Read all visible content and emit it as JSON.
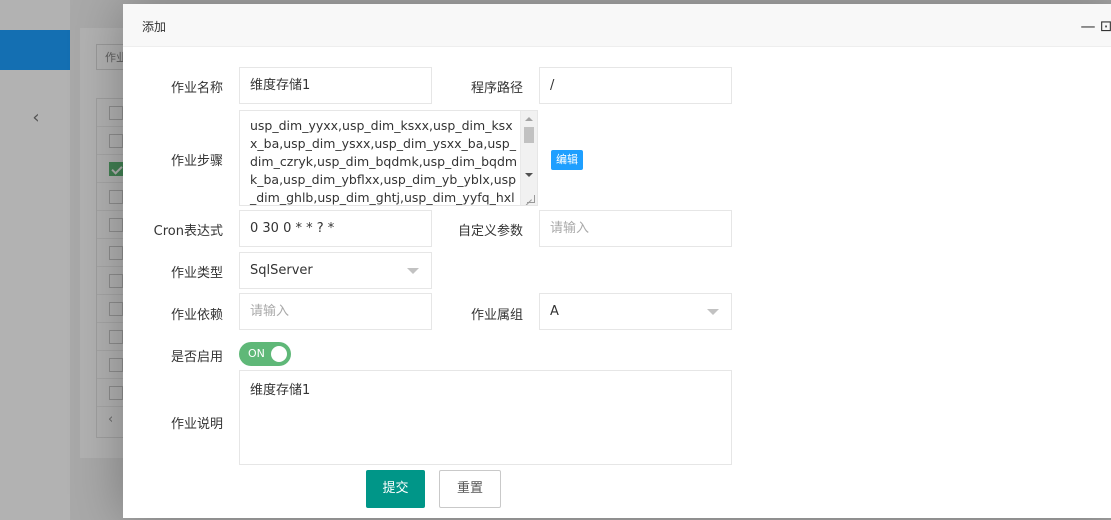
{
  "background": {
    "search_label": "作业",
    "checkbox_rows": 11,
    "checked_row_index": 2
  },
  "dialog": {
    "title": "添加",
    "window_buttons": {
      "minimize": "—",
      "maximize": "⊡",
      "close": "×"
    }
  },
  "form": {
    "job_name": {
      "label": "作业名称",
      "value": "维度存储1"
    },
    "program_path": {
      "label": "程序路径",
      "value": "/"
    },
    "job_steps": {
      "label": "作业步骤",
      "value": "usp_dim_yyxx,usp_dim_ksxx,usp_dim_ksxx_ba,usp_dim_ysxx,usp_dim_ysxx_ba,usp_dim_czryk,usp_dim_bqdmk,usp_dim_bqdmk_ba,usp_dim_ybflxx,usp_dim_yb_yblx,usp_dim_ghlb,usp_dim_ghtj,usp_dim_yyfq_hxlx,us",
      "edit_button": "编辑"
    },
    "cron": {
      "label": "Cron表达式",
      "value": "0 30 0 * * ? *"
    },
    "custom_params": {
      "label": "自定义参数",
      "placeholder": "请输入"
    },
    "job_type": {
      "label": "作业类型",
      "value": "SqlServer"
    },
    "job_dependency": {
      "label": "作业依赖",
      "placeholder": "请输入"
    },
    "job_group": {
      "label": "作业属组",
      "value": "A"
    },
    "enabled": {
      "label": "是否启用",
      "switch_text": "ON",
      "on": true
    },
    "description": {
      "label": "作业说明",
      "value": "维度存储1"
    }
  },
  "actions": {
    "submit": "提交",
    "reset": "重置"
  },
  "colors": {
    "primary": "#009688",
    "accent_blue": "#1e9fff",
    "switch_on": "#5fb878"
  }
}
